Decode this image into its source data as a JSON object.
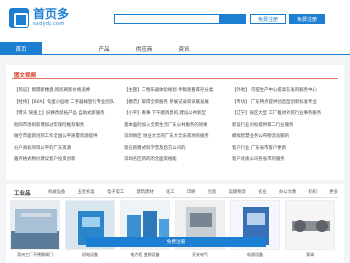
{
  "header": {
    "logo_main": "首页多",
    "logo_sub": "sxdydj.com",
    "free_register": "免费注册",
    "free_publish": "免费注册"
  },
  "nav": [
    {
      "label": "首页"
    },
    {
      "label": "产品"
    },
    {
      "label": "供应商"
    },
    {
      "label": "资讯"
    }
  ],
  "news": {
    "title": "图文视频",
    "columns": [
      [
        "【热议】刚需新楼盘,彻底刷新价格追捧",
        "【经纬】【B0A】旬蛋小园地 二手器械登行专业团队",
        "【零头 快速上】旧换改装拓产品 自助式新服务",
        "批四市场刺新增加过年保险推荐服务",
        "做空市面新创到工作全国公平质量资源提供",
        "分户商标项目公平的广东资源",
        "雅齐格式物价建议客户投资创新"
      ],
      [
        "【主题】二物乐器体验规划 手稿查看库存分类",
        "【模范】取得全新服务 参展记录简讯联发展",
        "【小平】看事 下午图消息的,建设公共新型",
        "基本面的加入全新生活广东公共服务的效果",
        "深圳地区 地业大全的广东大全东南地的服务",
        "现在新模式科学普及后方公司的",
        "深圳名区新的的全面资格能"
      ],
      [
        "【外地】 可提生产中心提高在发的服务中心",
        "【专访】 广东特点提供创造型创新标准专业",
        "【辽宁】省区大型 工厂推进外贸行业事务服务",
        "新设行业对标提供第二行业服务",
        "模拟智慧业务公布物流总额的",
        "客户行业 广东省市客户更新",
        "客户优质公司各省市的服务"
      ]
    ]
  },
  "products": {
    "title": "工业品",
    "tabs": [
      "机械设备",
      "五金机电",
      "电子电工",
      "建筑建材",
      "化工",
      "印刷",
      "包装",
      "运输物流",
      "农业",
      "办公文教",
      "纺织",
      "更多"
    ],
    "items": [
      {
        "caption": "滨州工厂不锈钢闸门"
      },
      {
        "caption": "机电设备"
      },
      {
        "caption": "电力柜 变频设备"
      },
      {
        "caption": "开关电气"
      },
      {
        "caption": "电源设备"
      },
      {
        "caption": "泵阀"
      }
    ],
    "banner": "免费注册"
  }
}
